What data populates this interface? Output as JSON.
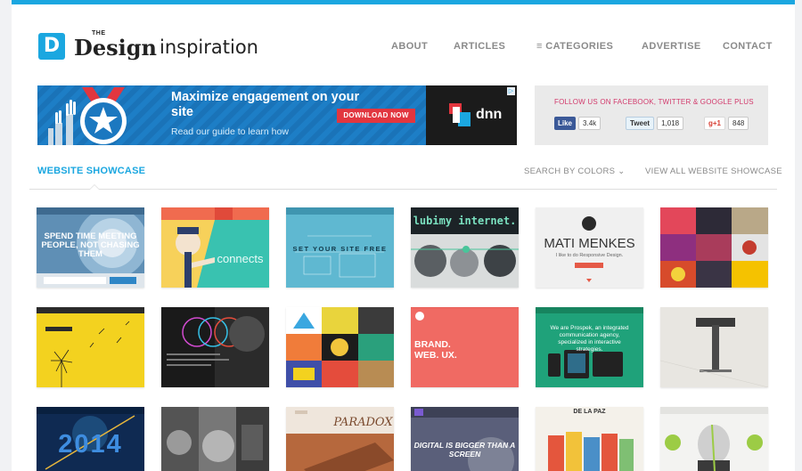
{
  "logo": {
    "mark": "D",
    "the": "THE",
    "design": "Design",
    "insp": "inspiration"
  },
  "nav": [
    "ABOUT",
    "ARTICLES",
    "≡ CATEGORIES",
    "ADVERTISE",
    "CONTACT"
  ],
  "banner": {
    "headline": "Maximize engagement on your site",
    "sub": "Read our guide to learn how",
    "cta": "DOWNLOAD NOW",
    "brand": "dnn"
  },
  "social": {
    "title": "FOLLOW US ON FACEBOOK, TWITTER & GOOGLE PLUS",
    "facebook": {
      "label": "Like",
      "count": "3.4k"
    },
    "twitter": {
      "label": "Tweet",
      "count": "1,018"
    },
    "google": {
      "label": "g+1",
      "count": "848"
    }
  },
  "section": {
    "title": "WEBSITE SHOWCASE",
    "search_colors": "SEARCH BY COLORS",
    "view_all": "VIEW ALL WEBSITE SHOWCASE"
  },
  "thumbnails": [
    {
      "caption": "SPEND TIME MEETING PEOPLE, NOT CHASING THEM",
      "theme": "blue-photo"
    },
    {
      "caption": "connects",
      "theme": "teal-uncle-sam"
    },
    {
      "caption": "SET YOUR SITE FREE",
      "theme": "light-blue-sketch"
    },
    {
      "caption": "lubimy internet.",
      "theme": "dark-green"
    },
    {
      "caption": "MATI MENKES",
      "sub": "I like to do Responsive Design.",
      "theme": "white-grey"
    },
    {
      "caption": "",
      "theme": "magenta-collage"
    },
    {
      "caption": "",
      "theme": "yellow-dandelion"
    },
    {
      "caption": "",
      "theme": "dark-studio"
    },
    {
      "caption": "",
      "theme": "colorful-grid"
    },
    {
      "caption": "BRAND. WEB. UX.",
      "theme": "coral"
    },
    {
      "caption": "We are Prospek, an integrated communication agency, specialized in interactive strategies.",
      "theme": "green-devices"
    },
    {
      "caption": "",
      "theme": "grey-lamp"
    },
    {
      "caption": "2014",
      "theme": "olympic-night"
    },
    {
      "caption": "",
      "theme": "bw-photos"
    },
    {
      "caption": "PARADOX",
      "theme": "wood"
    },
    {
      "caption": "DIGITAL IS BIGGER THAN A SCREEN",
      "theme": "purple-photo"
    },
    {
      "caption": "DE LA PAZ",
      "theme": "coffee-bags"
    },
    {
      "caption": "",
      "theme": "portrait-green"
    }
  ]
}
